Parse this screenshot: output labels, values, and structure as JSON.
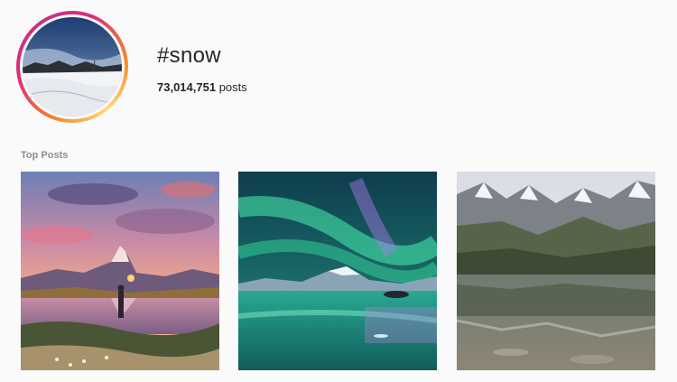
{
  "header": {
    "hashtag": "#snow",
    "post_count": "73,014,751",
    "post_count_suffix": " posts"
  },
  "sections": {
    "top_posts_label": "Top Posts"
  },
  "top_posts": [
    {
      "icon": "matterhorn-sunset-photo"
    },
    {
      "icon": "aurora-mountain-lake-photo"
    },
    {
      "icon": "alpine-lake-reflection-photo"
    }
  ]
}
